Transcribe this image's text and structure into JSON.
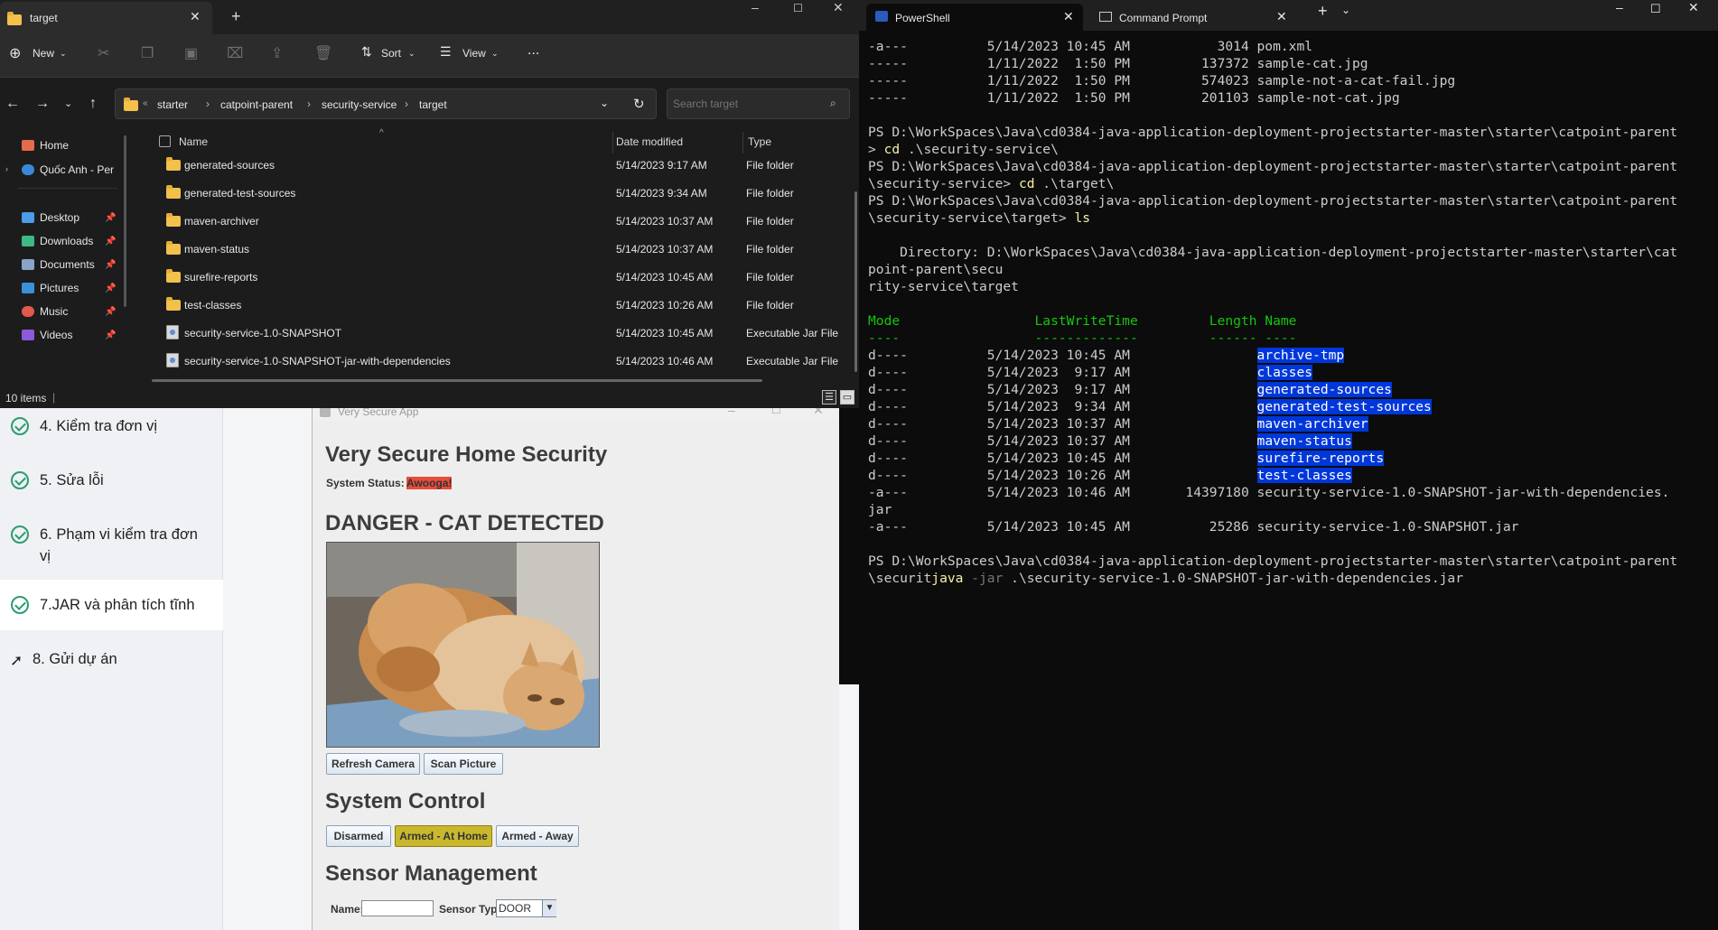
{
  "explorer": {
    "tab_title": "target",
    "toolbar": {
      "new_label": "New",
      "sort_label": "Sort",
      "view_label": "View",
      "more_label": "..."
    },
    "breadcrumb": [
      "starter",
      "catpoint-parent",
      "security-service",
      "target"
    ],
    "search_placeholder": "Search target",
    "nav": [
      {
        "label": "Home"
      },
      {
        "label": "Quốc Anh - Per"
      },
      {
        "label": "Desktop"
      },
      {
        "label": "Downloads"
      },
      {
        "label": "Documents"
      },
      {
        "label": "Pictures"
      },
      {
        "label": "Music"
      },
      {
        "label": "Videos"
      }
    ],
    "columns": {
      "name": "Name",
      "date": "Date modified",
      "type": "Type"
    },
    "files": [
      {
        "name": "generated-sources",
        "date": "5/14/2023 9:17 AM",
        "type": "File folder",
        "icon": "folder-icon"
      },
      {
        "name": "generated-test-sources",
        "date": "5/14/2023 9:34 AM",
        "type": "File folder",
        "icon": "folder-icon"
      },
      {
        "name": "maven-archiver",
        "date": "5/14/2023 10:37 AM",
        "type": "File folder",
        "icon": "folder-icon"
      },
      {
        "name": "maven-status",
        "date": "5/14/2023 10:37 AM",
        "type": "File folder",
        "icon": "folder-icon"
      },
      {
        "name": "surefire-reports",
        "date": "5/14/2023 10:45 AM",
        "type": "File folder",
        "icon": "folder-icon"
      },
      {
        "name": "test-classes",
        "date": "5/14/2023 10:26 AM",
        "type": "File folder",
        "icon": "folder-icon"
      },
      {
        "name": "security-service-1.0-SNAPSHOT",
        "date": "5/14/2023 10:45 AM",
        "type": "Executable Jar File",
        "icon": "jar-icon"
      },
      {
        "name": "security-service-1.0-SNAPSHOT-jar-with-dependencies",
        "date": "5/14/2023 10:46 AM",
        "type": "Executable Jar File",
        "icon": "jar-icon"
      }
    ],
    "status": "10 items"
  },
  "course": {
    "lessons": [
      {
        "label": "4. Kiểm tra đơn vị",
        "done": true
      },
      {
        "label": "5. Sửa lỗi",
        "done": true
      },
      {
        "label": "6. Phạm vi kiểm tra đơn vị",
        "done": true
      },
      {
        "label": "7.JAR và phân tích tĩnh",
        "done": true
      },
      {
        "label": "8. Gửi dự án",
        "done": false
      }
    ]
  },
  "javaapp": {
    "window_title": "Very Secure App",
    "heading": "Very Secure Home Security",
    "status_label": "System Status:",
    "status_value": "Awooga!",
    "status_color": "#e74c3c",
    "alert": "DANGER - CAT DETECTED",
    "refresh_button": "Refresh Camera",
    "scan_button": "Scan Picture",
    "control_heading": "System Control",
    "control_buttons": [
      {
        "label": "Disarmed",
        "selected": false
      },
      {
        "label": "Armed - At Home",
        "selected": true
      },
      {
        "label": "Armed - Away",
        "selected": false
      }
    ],
    "armed_color": "#c9b82d",
    "sensor_heading": "Sensor Management",
    "name_label": "Name:",
    "name_value": "",
    "sensor_type_label": "Sensor Type:",
    "sensor_type_value": "DOOR"
  },
  "terminal": {
    "tabs": [
      {
        "label": "PowerShell",
        "active": true
      },
      {
        "label": "Command Prompt",
        "active": false
      }
    ],
    "lines": [
      [
        [
          "-a---          5/14/2023 10:45 AM           3014 pom.xml",
          ""
        ]
      ],
      [
        [
          "-----          1/11/2022  1:50 PM         137372 sample-cat.jpg",
          ""
        ]
      ],
      [
        [
          "-----          1/11/2022  1:50 PM         574023 sample-not-a-cat-fail.jpg",
          ""
        ]
      ],
      [
        [
          "-----          1/11/2022  1:50 PM         201103 sample-not-cat.jpg",
          ""
        ]
      ],
      [
        [
          "",
          ""
        ]
      ],
      [
        [
          "PS D:\\WorkSpaces\\Java\\cd0384-java-application-deployment-projectstarter-master\\starter\\catpoint-parent",
          ""
        ]
      ],
      [
        [
          "> ",
          ""
        ],
        [
          "cd",
          "yellow"
        ],
        [
          " .\\security-service\\",
          ""
        ]
      ],
      [
        [
          "PS D:\\WorkSpaces\\Java\\cd0384-java-application-deployment-projectstarter-master\\starter\\catpoint-parent",
          ""
        ]
      ],
      [
        [
          "\\security-service> ",
          ""
        ],
        [
          "cd",
          "yellow"
        ],
        [
          " .\\target\\",
          ""
        ]
      ],
      [
        [
          "PS D:\\WorkSpaces\\Java\\cd0384-java-application-deployment-projectstarter-master\\starter\\catpoint-parent",
          ""
        ]
      ],
      [
        [
          "\\security-service\\target> ",
          ""
        ],
        [
          "ls",
          "yellow"
        ]
      ],
      [
        [
          "",
          ""
        ]
      ],
      [
        [
          "    Directory: D:\\WorkSpaces\\Java\\cd0384-java-application-deployment-projectstarter-master\\starter\\cat",
          ""
        ]
      ],
      [
        [
          "point-parent\\secu",
          ""
        ]
      ],
      [
        [
          "rity-service\\target",
          ""
        ]
      ],
      [
        [
          "",
          ""
        ]
      ],
      [
        [
          "Mode                 LastWriteTime         Length Name",
          "green"
        ]
      ],
      [
        [
          "----                 -------------         ------ ----",
          "green"
        ]
      ],
      [
        [
          "d----          5/14/2023 10:45 AM                ",
          ""
        ],
        [
          "archive-tmp",
          "hl"
        ]
      ],
      [
        [
          "d----          5/14/2023  9:17 AM                ",
          ""
        ],
        [
          "classes",
          "hl"
        ]
      ],
      [
        [
          "d----          5/14/2023  9:17 AM                ",
          ""
        ],
        [
          "generated-sources",
          "hl"
        ]
      ],
      [
        [
          "d----          5/14/2023  9:34 AM                ",
          ""
        ],
        [
          "generated-test-sources",
          "hl"
        ]
      ],
      [
        [
          "d----          5/14/2023 10:37 AM                ",
          ""
        ],
        [
          "maven-archiver",
          "hl"
        ]
      ],
      [
        [
          "d----          5/14/2023 10:37 AM                ",
          ""
        ],
        [
          "maven-status",
          "hl"
        ]
      ],
      [
        [
          "d----          5/14/2023 10:45 AM                ",
          ""
        ],
        [
          "surefire-reports",
          "hl"
        ]
      ],
      [
        [
          "d----          5/14/2023 10:26 AM                ",
          ""
        ],
        [
          "test-classes",
          "hl"
        ]
      ],
      [
        [
          "-a---          5/14/2023 10:46 AM       14397180 security-service-1.0-SNAPSHOT-jar-with-dependencies.",
          ""
        ]
      ],
      [
        [
          "jar",
          ""
        ]
      ],
      [
        [
          "-a---          5/14/2023 10:45 AM          25286 security-service-1.0-SNAPSHOT.jar",
          ""
        ]
      ],
      [
        [
          "",
          ""
        ]
      ],
      [
        [
          "PS D:\\WorkSpaces\\Java\\cd0384-java-application-deployment-projectstarter-master\\starter\\catpoint-parent",
          ""
        ]
      ],
      [
        [
          "\\securit",
          ""
        ],
        [
          "java",
          "yellow"
        ],
        [
          " -jar",
          "gray"
        ],
        [
          " .\\security-service-1.0-SNAPSHOT-jar-with-dependencies.jar",
          ""
        ]
      ]
    ]
  }
}
